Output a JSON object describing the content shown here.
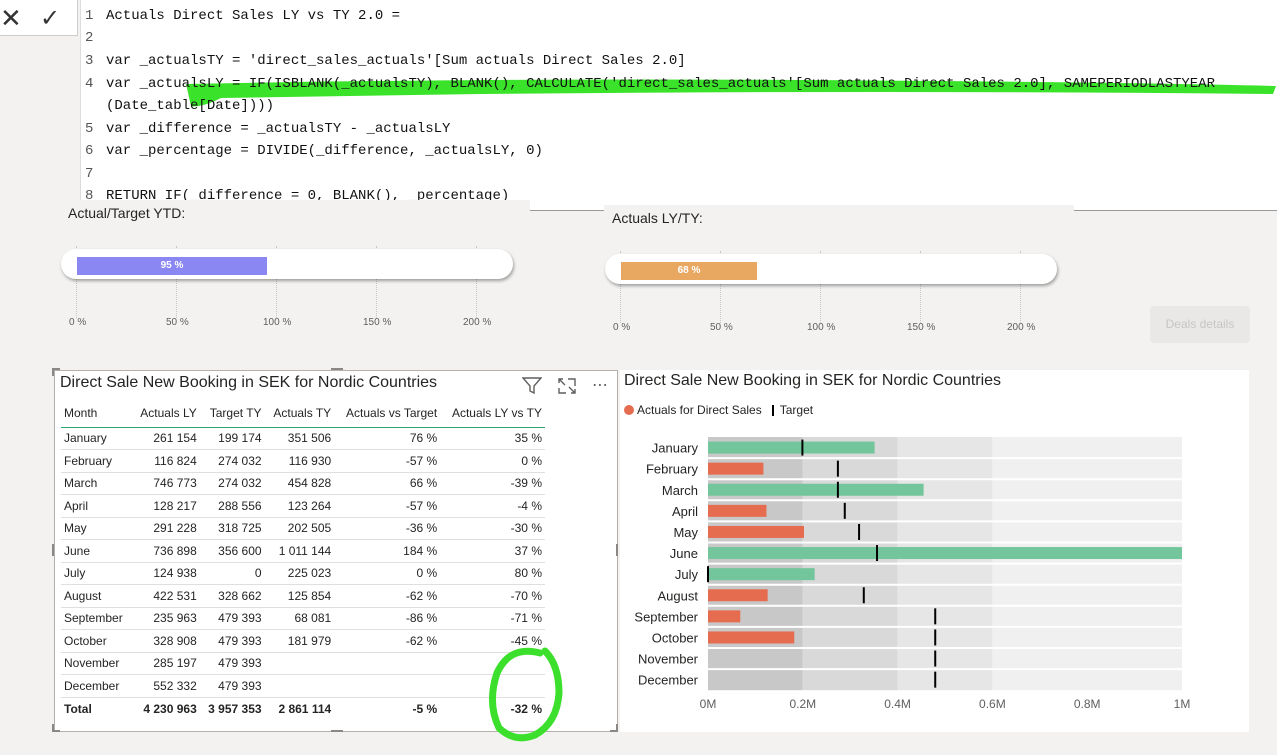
{
  "formula": {
    "cancel_icon": "close-icon",
    "commit_icon": "check-icon",
    "lines": [
      {
        "n": "1",
        "text": "Actuals Direct Sales LY vs TY 2.0 ="
      },
      {
        "n": "2",
        "text": ""
      },
      {
        "n": "3",
        "text": "var _actualsTY = 'direct_sales_actuals'[Sum actuals Direct Sales 2.0]"
      },
      {
        "n": "4",
        "text": "var _actualsLY = IF(ISBLANK(_actualsTY), BLANK(), CALCULATE('direct_sales_actuals'[Sum actuals Direct Sales 2.0], SAMEPERIODLASTYEAR"
      },
      {
        "n": "",
        "text": "(Date_table[Date])))"
      },
      {
        "n": "5",
        "text": "var _difference = _actualsTY - _actualsLY"
      },
      {
        "n": "6",
        "text": "var _percentage = DIVIDE(_difference, _actualsLY, 0)"
      },
      {
        "n": "7",
        "text": ""
      },
      {
        "n": "8",
        "text": "RETURN IF(_difference = 0, BLANK(), _percentage)"
      }
    ]
  },
  "gauges": [
    {
      "title": "Actual/Target YTD:",
      "label": "95 %",
      "value": 95,
      "color": "#8b87f2",
      "ticks": [
        "0 %",
        "50 %",
        "100 %",
        "150 %",
        "200 %"
      ]
    },
    {
      "title": "Actuals LY/TY:",
      "label": "68 %",
      "value": 68,
      "color": "#e8a862",
      "ticks": [
        "0 %",
        "50 %",
        "100 %",
        "150 %",
        "200 %"
      ]
    }
  ],
  "deals_button": "Deals details",
  "table": {
    "title": "Direct Sale New Booking in SEK for Nordic Countries",
    "columns": [
      "Month",
      "Actuals LY",
      "Target TY",
      "Actuals TY",
      "Actuals vs Target",
      "Actuals LY vs TY"
    ],
    "rows": [
      [
        "January",
        "261 154",
        "199 174",
        "351 506",
        "76 %",
        "35 %"
      ],
      [
        "February",
        "116 824",
        "274 032",
        "116 930",
        "-57 %",
        "0 %"
      ],
      [
        "March",
        "746 773",
        "274 032",
        "454 828",
        "66 %",
        "-39 %"
      ],
      [
        "April",
        "128 217",
        "288 556",
        "123 264",
        "-57 %",
        "-4 %"
      ],
      [
        "May",
        "291 228",
        "318 725",
        "202 505",
        "-36 %",
        "-30 %"
      ],
      [
        "June",
        "736 898",
        "356 600",
        "1 011 144",
        "184 %",
        "37 %"
      ],
      [
        "July",
        "124 938",
        "0",
        "225 023",
        "0 %",
        "80 %"
      ],
      [
        "August",
        "422 531",
        "328 662",
        "125 854",
        "-62 %",
        "-70 %"
      ],
      [
        "September",
        "235 963",
        "479 393",
        "68 081",
        "-86 %",
        "-71 %"
      ],
      [
        "October",
        "328 908",
        "479 393",
        "181 979",
        "-62 %",
        "-45 %"
      ],
      [
        "November",
        "285 197",
        "479 393",
        "",
        "",
        ""
      ],
      [
        "December",
        "552 332",
        "479 393",
        "",
        "",
        ""
      ]
    ],
    "total": [
      "Total",
      "4 230 963",
      "3 957 353",
      "2 861 114",
      "-5 %",
      "-32 %"
    ],
    "icons": [
      "filter-icon",
      "focus-mode-icon",
      "more-options-icon"
    ]
  },
  "chart_data": {
    "type": "bar",
    "title": "Direct Sale New Booking in SEK for Nordic Countries",
    "legend": [
      "Actuals for Direct Sales",
      "Target"
    ],
    "legend_position": "top-left",
    "categories": [
      "January",
      "February",
      "March",
      "April",
      "May",
      "June",
      "July",
      "August",
      "September",
      "October",
      "November",
      "December"
    ],
    "actuals": [
      351506,
      116930,
      454828,
      123264,
      202505,
      1011144,
      225023,
      125854,
      68081,
      181979,
      null,
      null
    ],
    "targets": [
      199174,
      274032,
      274032,
      288556,
      318725,
      356600,
      0,
      328662,
      479393,
      479393,
      479393,
      479393
    ],
    "above_target": [
      true,
      false,
      true,
      false,
      false,
      true,
      true,
      false,
      false,
      false,
      false,
      false
    ],
    "colors": {
      "above": "#73c69b",
      "below": "#e66c4f",
      "target": "#000000"
    },
    "xticks": [
      "0M",
      "0.2M",
      "0.4M",
      "0.6M",
      "0.8M",
      "1M"
    ],
    "xlim": [
      0,
      1000000
    ],
    "bands": [
      200000,
      400000,
      600000,
      1000000
    ]
  }
}
